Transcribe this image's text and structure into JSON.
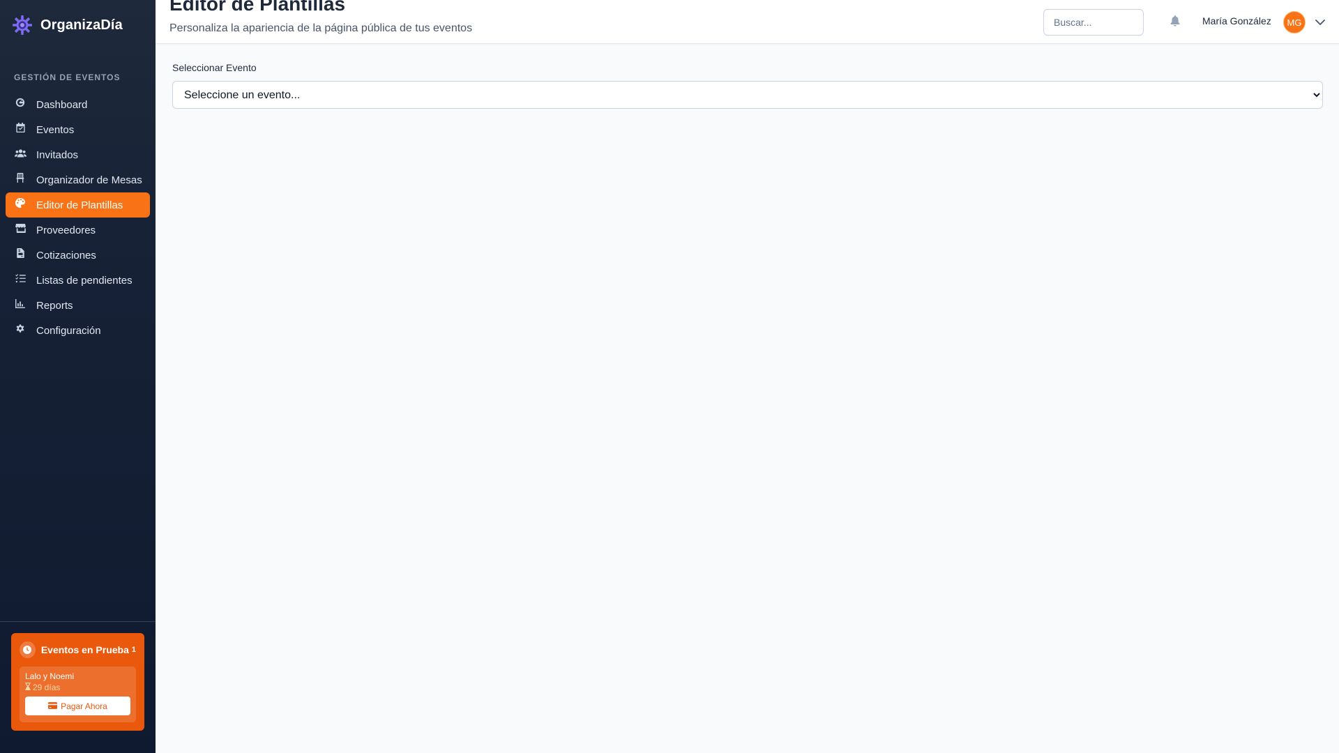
{
  "brand": {
    "name": "OrganizaDía"
  },
  "sidebar": {
    "section_title": "GESTIÓN DE EVENTOS",
    "items": [
      {
        "label": "Dashboard",
        "icon": "dashboard-icon"
      },
      {
        "label": "Eventos",
        "icon": "calendar-icon"
      },
      {
        "label": "Invitados",
        "icon": "users-icon"
      },
      {
        "label": "Organizador de Mesas",
        "icon": "chair-icon"
      },
      {
        "label": "Editor de Plantillas",
        "icon": "palette-icon",
        "active": true
      },
      {
        "label": "Proveedores",
        "icon": "store-icon"
      },
      {
        "label": "Cotizaciones",
        "icon": "file-invoice-icon"
      },
      {
        "label": "Listas de pendientes",
        "icon": "list-check-icon"
      },
      {
        "label": "Reports",
        "icon": "chart-icon"
      },
      {
        "label": "Configuración",
        "icon": "gear-icon"
      }
    ],
    "trial": {
      "title": "Eventos en Prueba",
      "count": "1",
      "item_name": "Lalo y Noemi",
      "item_days": "29 días",
      "pay_label": "Pagar Ahora"
    }
  },
  "header": {
    "title": "Editor de Plantillas",
    "subtitle": "Personaliza la apariencia de la página pública de tus eventos",
    "search_placeholder": "Buscar...",
    "user_name": "María González",
    "user_initials": "MG"
  },
  "main": {
    "select_label": "Seleccionar Evento",
    "select_value": "Seleccione un evento..."
  },
  "colors": {
    "accent": "#f97316",
    "trial_bg": "#ea580c",
    "sidebar_bg": "#1e293b"
  }
}
